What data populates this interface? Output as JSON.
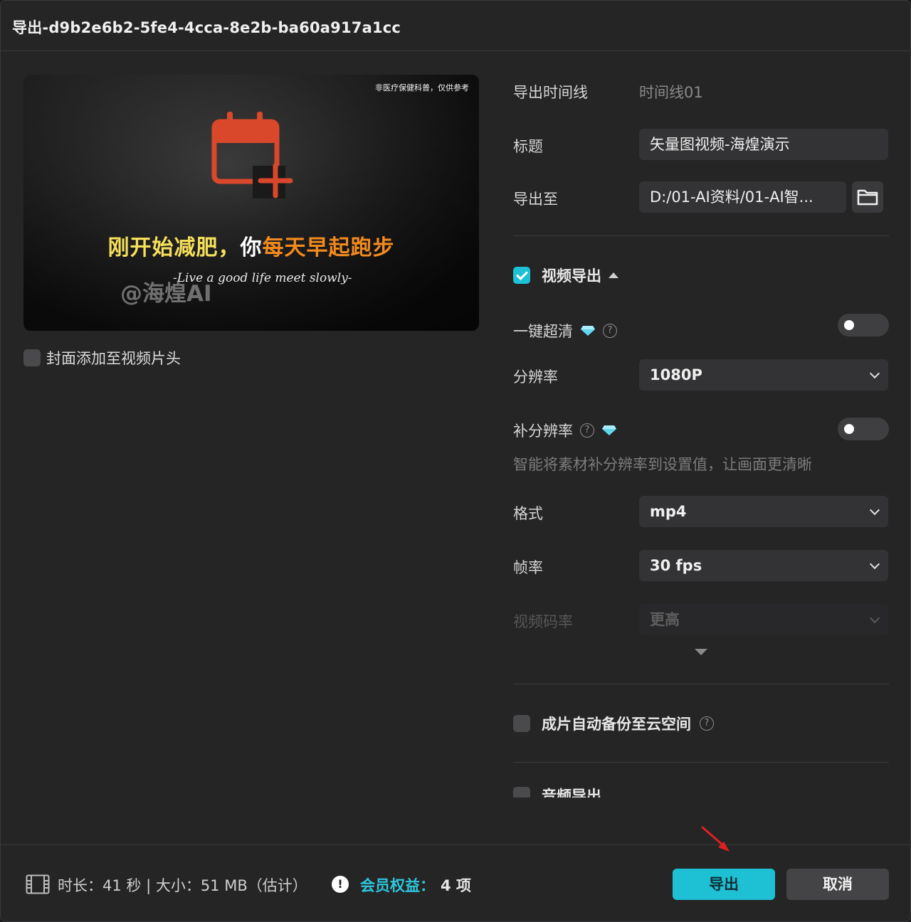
{
  "dialog": {
    "title": "导出-d9b2e6b2-5fe4-4cca-8e2b-ba60a917a1cc"
  },
  "preview": {
    "disclaimer": "非医疗保健科普，仅供参考",
    "headline_part1": "刚开始减肥，",
    "headline_part2": "你",
    "headline_part3": "每天早起跑步",
    "watermark": "@海煌AI",
    "subline": "-Live a good life meet slowly-",
    "icon": "calendar-add-icon"
  },
  "cover": {
    "label": "封面添加至视频片头",
    "checked": false
  },
  "settings": {
    "timeline_label": "导出时间线",
    "timeline_value": "时间线01",
    "title_label": "标题",
    "title_value": "矢量图视频-海煌演示",
    "export_to_label": "导出至",
    "export_to_value": "D:/01-AI资料/01-AI智...",
    "video_export_label": "视频导出",
    "video_export_checked": true,
    "hd_label": "一键超清",
    "resolution_label": "分辨率",
    "resolution_value": "1080P",
    "supplement_label": "补分辨率",
    "supplement_hint": "智能将素材补分辨率到设置值，让画面更清晰",
    "format_label": "格式",
    "format_value": "mp4",
    "fps_label": "帧率",
    "fps_value": "30 fps",
    "bitrate_label": "视频码率",
    "bitrate_value": "更高",
    "cloud_backup_label": "成片自动备份至云空间",
    "audio_export_label": "音频导出"
  },
  "footer": {
    "stats": "时长：41 秒 | 大小：51 MB（估计）",
    "vip_label": "会员权益：",
    "vip_count": "4 项",
    "export_button": "导出",
    "cancel_button": "取消"
  },
  "colors": {
    "accent": "#1ec0d4",
    "background": "#252526",
    "field": "#333335",
    "headline_yellow": "#f6e05a",
    "headline_orange": "#f28a1e",
    "calendar_red": "#d9482a",
    "arrow_red": "#e02020"
  }
}
